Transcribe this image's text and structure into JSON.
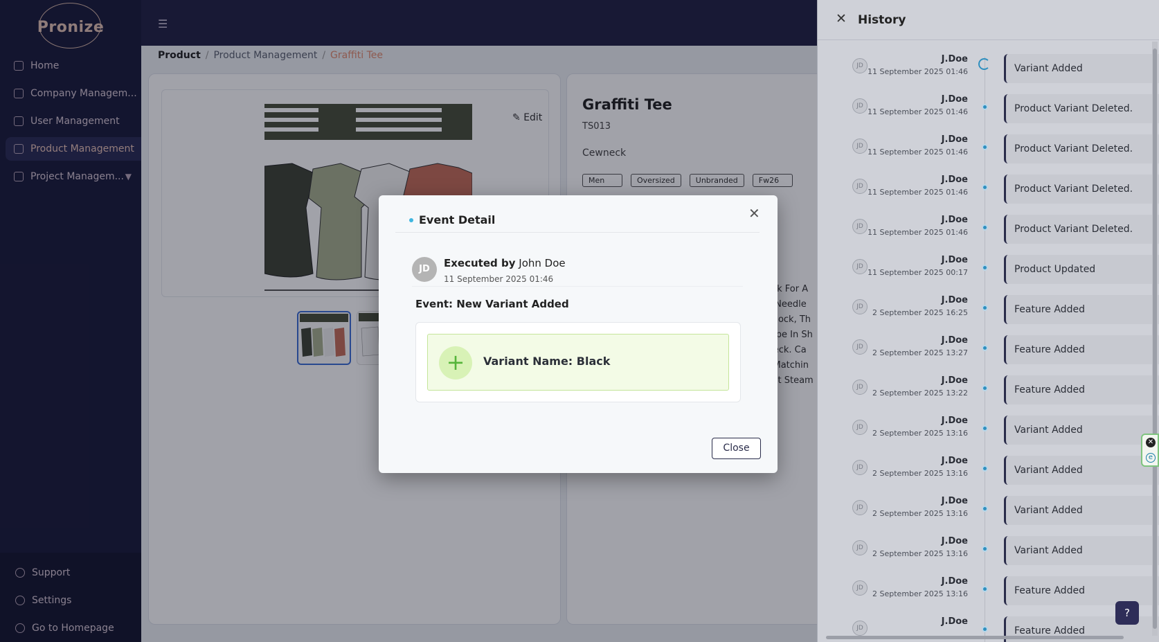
{
  "app": {
    "logo": "Pronize"
  },
  "sidebar": {
    "items": [
      {
        "label": "Home",
        "icon": "dashboard-icon"
      },
      {
        "label": "Company Managem...",
        "icon": "bank-icon"
      },
      {
        "label": "User Management",
        "icon": "user-icon"
      },
      {
        "label": "Product Management",
        "icon": "grid-icon",
        "active": true
      },
      {
        "label": "Project Managem...",
        "icon": "terminal-icon"
      }
    ],
    "bottom": [
      {
        "label": "Support",
        "icon": "headset-icon"
      },
      {
        "label": "Settings",
        "icon": "gear-icon"
      },
      {
        "label": "Go to Homepage",
        "icon": "exit-icon"
      }
    ]
  },
  "breadcrumb": {
    "root": "Product",
    "middle": "Product Management",
    "current": "Graffiti Tee"
  },
  "product": {
    "edit_label": "Edit",
    "title": "Graffiti Tee",
    "sku": "TS013",
    "neckline": "Cewneck",
    "tags": [
      "Men",
      "Oversized",
      "Unbranded",
      "Fw26"
    ],
    "desc_lines": [
      "ock For A",
      "e Needle",
      "erlock, Th",
      "Tape In Sh",
      "Neck. Ca",
      "r Matchin",
      "ght Steam"
    ]
  },
  "history": {
    "title": "History",
    "entries": [
      {
        "user": "J.Doe",
        "date": "11 September 2025 01:46",
        "event": "Variant Added"
      },
      {
        "user": "J.Doe",
        "date": "11 September 2025 01:46",
        "event": "Product Variant Deleted."
      },
      {
        "user": "J.Doe",
        "date": "11 September 2025 01:46",
        "event": "Product Variant Deleted."
      },
      {
        "user": "J.Doe",
        "date": "11 September 2025 01:46",
        "event": "Product Variant Deleted."
      },
      {
        "user": "J.Doe",
        "date": "11 September 2025 01:46",
        "event": "Product Variant Deleted."
      },
      {
        "user": "J.Doe",
        "date": "11 September 2025 00:17",
        "event": "Product Updated"
      },
      {
        "user": "J.Doe",
        "date": "2 September 2025 16:25",
        "event": "Feature Added"
      },
      {
        "user": "J.Doe",
        "date": "2 September 2025 13:27",
        "event": "Feature Added"
      },
      {
        "user": "J.Doe",
        "date": "2 September 2025 13:22",
        "event": "Feature Added"
      },
      {
        "user": "J.Doe",
        "date": "2 September 2025 13:16",
        "event": "Variant Added"
      },
      {
        "user": "J.Doe",
        "date": "2 September 2025 13:16",
        "event": "Variant Added"
      },
      {
        "user": "J.Doe",
        "date": "2 September 2025 13:16",
        "event": "Variant Added"
      },
      {
        "user": "J.Doe",
        "date": "2 September 2025 13:16",
        "event": "Variant Added"
      },
      {
        "user": "J.Doe",
        "date": "2 September 2025 13:16",
        "event": "Feature Added"
      },
      {
        "user": "J.Doe",
        "date": "",
        "event": "Feature Added"
      }
    ]
  },
  "modal": {
    "title": "Event Detail",
    "avatar_initials": "JD",
    "executed_by_label": "Executed by",
    "executed_by_name": "John Doe",
    "date": "11 September 2025 01:46",
    "event_label": "Event: New Variant Added",
    "variant_text": "Variant Name: Black",
    "close_label": "Close"
  },
  "colors": {
    "sidebar": "#1b1c3a",
    "accent": "#e08b6f",
    "timeline": "#2f8fbf",
    "success": "#55b53a"
  }
}
